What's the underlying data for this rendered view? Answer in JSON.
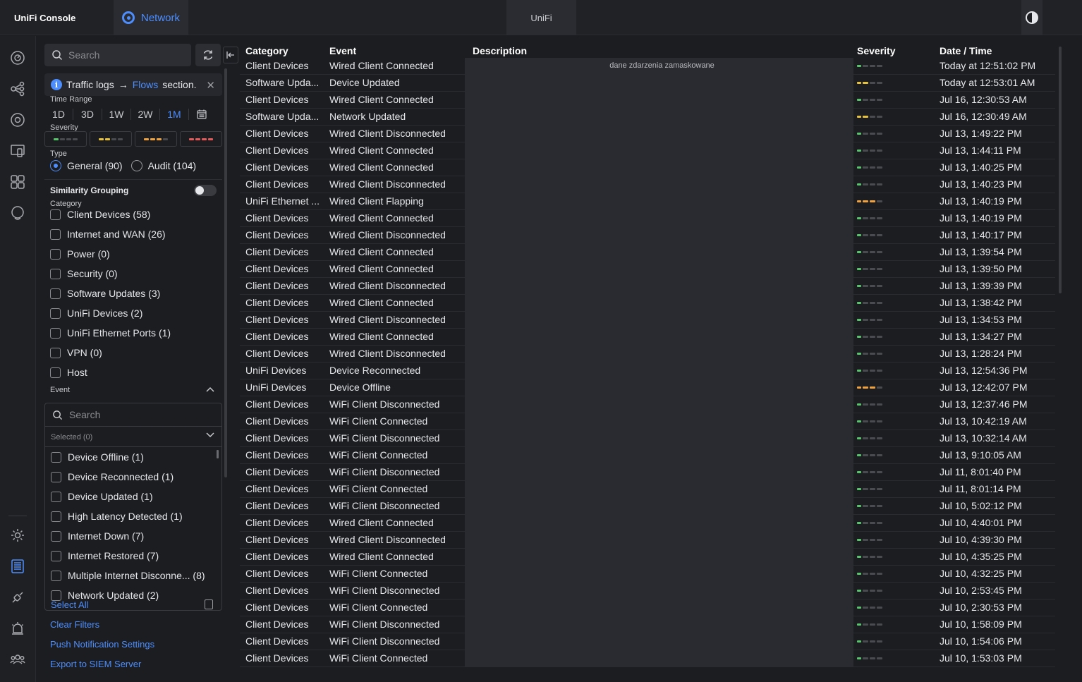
{
  "topbar": {
    "console_title": "UniFi Console",
    "app_label": "Network",
    "center_label": "UniFi",
    "accent": "#4d8eff"
  },
  "rail": {
    "icons": [
      "dashboard-icon",
      "topology-icon",
      "devices-icon",
      "clients-icon",
      "apps-icon",
      "insights-icon",
      "settings-icon",
      "logs-icon",
      "integrations-icon",
      "alarms-icon",
      "admins-icon"
    ],
    "active": "logs-icon"
  },
  "filters": {
    "search_placeholder": "Search",
    "banner": {
      "prefix": "Traffic logs",
      "arrow": "→",
      "link": "Flows",
      "suffix": "section."
    },
    "time_range_label": "Time Range",
    "time_ranges": [
      "1D",
      "3D",
      "1W",
      "2W",
      "1M"
    ],
    "time_range_active": "1M",
    "severity_label": "Severity",
    "severity_levels": [
      {
        "level": 1,
        "color": "#58c46b"
      },
      {
        "level": 2,
        "color": "#e9c23b"
      },
      {
        "level": 3,
        "color": "#f0a140"
      },
      {
        "level": 4,
        "color": "#e55a5a"
      }
    ],
    "type_label": "Type",
    "types": [
      {
        "label": "General (90)",
        "selected": true
      },
      {
        "label": "Audit (104)",
        "selected": false
      }
    ],
    "similarity_label": "Similarity Grouping",
    "similarity_on": false,
    "category_label": "Category",
    "categories": [
      "Client Devices (58)",
      "Internet and WAN (26)",
      "Power (0)",
      "Security (0)",
      "Software Updates (3)",
      "UniFi Devices (2)",
      "UniFi Ethernet Ports (1)",
      "VPN (0)",
      "Host"
    ],
    "event_label": "Event",
    "event_search_placeholder": "Search",
    "event_selected": "Selected (0)",
    "events": [
      "Device Offline (1)",
      "Device Reconnected (1)",
      "Device Updated (1)",
      "High Latency Detected (1)",
      "Internet Down (7)",
      "Internet Restored (7)",
      "Multiple Internet Disconne... (8)",
      "Network Updated (2)"
    ],
    "select_all": "Select All",
    "clear_filters": "Clear Filters",
    "push_settings": "Push Notification Settings",
    "export_siem": "Export to SIEM Server"
  },
  "table": {
    "headers": [
      "Category",
      "Event",
      "Description",
      "Severity",
      "Date / Time"
    ],
    "masked_text": "dane zdarzenia zamaskowane",
    "severity_colors": {
      "1": "#58c46b",
      "2": "#e9c23b",
      "3": "#f0a140"
    },
    "rows": [
      {
        "category": "Client Devices",
        "event": "Wired Client Connected",
        "severity": 1,
        "datetime": "Today at 12:51:02 PM"
      },
      {
        "category": "Software Upda...",
        "event": "Device Updated",
        "severity": 2,
        "datetime": "Today at 12:53:01 AM"
      },
      {
        "category": "Client Devices",
        "event": "Wired Client Connected",
        "severity": 1,
        "datetime": "Jul 16, 12:30:53 AM"
      },
      {
        "category": "Software Upda...",
        "event": "Network Updated",
        "severity": 2,
        "datetime": "Jul 16, 12:30:49 AM"
      },
      {
        "category": "Client Devices",
        "event": "Wired Client Disconnected",
        "severity": 1,
        "datetime": "Jul 13, 1:49:22 PM"
      },
      {
        "category": "Client Devices",
        "event": "Wired Client Connected",
        "severity": 1,
        "datetime": "Jul 13, 1:44:11 PM"
      },
      {
        "category": "Client Devices",
        "event": "Wired Client Connected",
        "severity": 1,
        "datetime": "Jul 13, 1:40:25 PM"
      },
      {
        "category": "Client Devices",
        "event": "Wired Client Disconnected",
        "severity": 1,
        "datetime": "Jul 13, 1:40:23 PM"
      },
      {
        "category": "UniFi Ethernet ...",
        "event": "Wired Client Flapping",
        "severity": 3,
        "datetime": "Jul 13, 1:40:19 PM"
      },
      {
        "category": "Client Devices",
        "event": "Wired Client Connected",
        "severity": 1,
        "datetime": "Jul 13, 1:40:19 PM"
      },
      {
        "category": "Client Devices",
        "event": "Wired Client Disconnected",
        "severity": 1,
        "datetime": "Jul 13, 1:40:17 PM"
      },
      {
        "category": "Client Devices",
        "event": "Wired Client Connected",
        "severity": 1,
        "datetime": "Jul 13, 1:39:54 PM"
      },
      {
        "category": "Client Devices",
        "event": "Wired Client Connected",
        "severity": 1,
        "datetime": "Jul 13, 1:39:50 PM"
      },
      {
        "category": "Client Devices",
        "event": "Wired Client Disconnected",
        "severity": 1,
        "datetime": "Jul 13, 1:39:39 PM"
      },
      {
        "category": "Client Devices",
        "event": "Wired Client Connected",
        "severity": 1,
        "datetime": "Jul 13, 1:38:42 PM"
      },
      {
        "category": "Client Devices",
        "event": "Wired Client Disconnected",
        "severity": 1,
        "datetime": "Jul 13, 1:34:53 PM"
      },
      {
        "category": "Client Devices",
        "event": "Wired Client Connected",
        "severity": 1,
        "datetime": "Jul 13, 1:34:27 PM"
      },
      {
        "category": "Client Devices",
        "event": "Wired Client Disconnected",
        "severity": 1,
        "datetime": "Jul 13, 1:28:24 PM"
      },
      {
        "category": "UniFi Devices",
        "event": "Device Reconnected",
        "severity": 1,
        "datetime": "Jul 13, 12:54:36 PM"
      },
      {
        "category": "UniFi Devices",
        "event": "Device Offline",
        "severity": 3,
        "datetime": "Jul 13, 12:42:07 PM"
      },
      {
        "category": "Client Devices",
        "event": "WiFi Client Disconnected",
        "severity": 1,
        "datetime": "Jul 13, 12:37:46 PM"
      },
      {
        "category": "Client Devices",
        "event": "WiFi Client Connected",
        "severity": 1,
        "datetime": "Jul 13, 10:42:19 AM"
      },
      {
        "category": "Client Devices",
        "event": "WiFi Client Disconnected",
        "severity": 1,
        "datetime": "Jul 13, 10:32:14 AM"
      },
      {
        "category": "Client Devices",
        "event": "WiFi Client Connected",
        "severity": 1,
        "datetime": "Jul 13, 9:10:05 AM"
      },
      {
        "category": "Client Devices",
        "event": "WiFi Client Disconnected",
        "severity": 1,
        "datetime": "Jul 11, 8:01:40 PM"
      },
      {
        "category": "Client Devices",
        "event": "WiFi Client Connected",
        "severity": 1,
        "datetime": "Jul 11, 8:01:14 PM"
      },
      {
        "category": "Client Devices",
        "event": "WiFi Client Disconnected",
        "severity": 1,
        "datetime": "Jul 10, 5:02:12 PM"
      },
      {
        "category": "Client Devices",
        "event": "Wired Client Connected",
        "severity": 1,
        "datetime": "Jul 10, 4:40:01 PM"
      },
      {
        "category": "Client Devices",
        "event": "Wired Client Disconnected",
        "severity": 1,
        "datetime": "Jul 10, 4:39:30 PM"
      },
      {
        "category": "Client Devices",
        "event": "Wired Client Connected",
        "severity": 1,
        "datetime": "Jul 10, 4:35:25 PM"
      },
      {
        "category": "Client Devices",
        "event": "WiFi Client Connected",
        "severity": 1,
        "datetime": "Jul 10, 4:32:25 PM"
      },
      {
        "category": "Client Devices",
        "event": "WiFi Client Disconnected",
        "severity": 1,
        "datetime": "Jul 10, 2:53:45 PM"
      },
      {
        "category": "Client Devices",
        "event": "WiFi Client Connected",
        "severity": 1,
        "datetime": "Jul 10, 2:30:53 PM"
      },
      {
        "category": "Client Devices",
        "event": "WiFi Client Disconnected",
        "severity": 1,
        "datetime": "Jul 10, 1:58:09 PM"
      },
      {
        "category": "Client Devices",
        "event": "WiFi Client Disconnected",
        "severity": 1,
        "datetime": "Jul 10, 1:54:06 PM"
      },
      {
        "category": "Client Devices",
        "event": "WiFi Client Connected",
        "severity": 1,
        "datetime": "Jul 10, 1:53:03 PM"
      }
    ]
  }
}
